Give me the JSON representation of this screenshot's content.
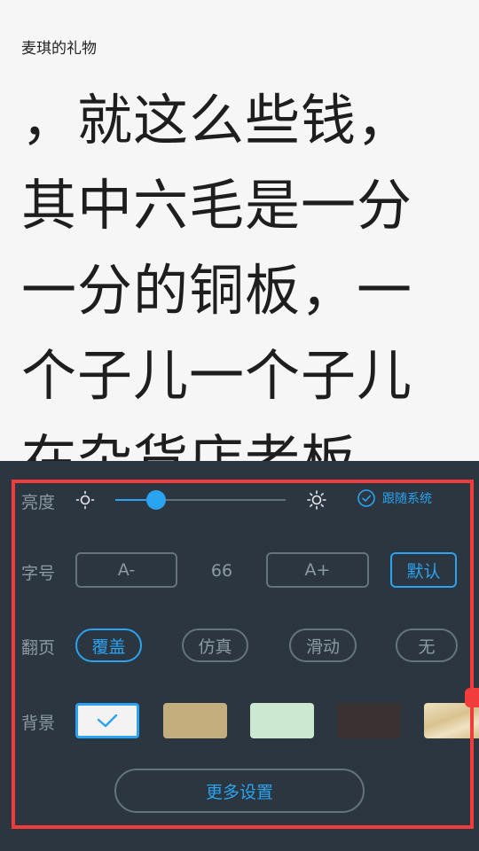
{
  "book": {
    "title": "麦琪的礼物",
    "lines": [
      "，就这么些钱，",
      "其中六毛是一分",
      "一分的铜板，一",
      "个子儿一个子儿",
      "在杂货店老板"
    ]
  },
  "settings": {
    "brightness": {
      "label": "亮度",
      "level": 0.24,
      "follow_system_label": "跟随系统",
      "follow_system_checked": true
    },
    "font_size": {
      "label": "字号",
      "decrease_label": "A-",
      "value": "66",
      "increase_label": "A+",
      "default_label": "默认"
    },
    "page_turn": {
      "label": "翻页",
      "options": [
        "覆盖",
        "仿真",
        "滑动",
        "无"
      ],
      "selected": "覆盖"
    },
    "background": {
      "label": "背景",
      "swatches": [
        "#f3f3f3",
        "#c4ae7e",
        "#cde8d1",
        "#3a3232",
        "#e6d3a6"
      ],
      "selected_index": 0
    },
    "more_label": "更多设置"
  },
  "colors": {
    "accent": "#2aa3f0",
    "panel": "#2b3640",
    "highlight": "#f23c3c"
  }
}
